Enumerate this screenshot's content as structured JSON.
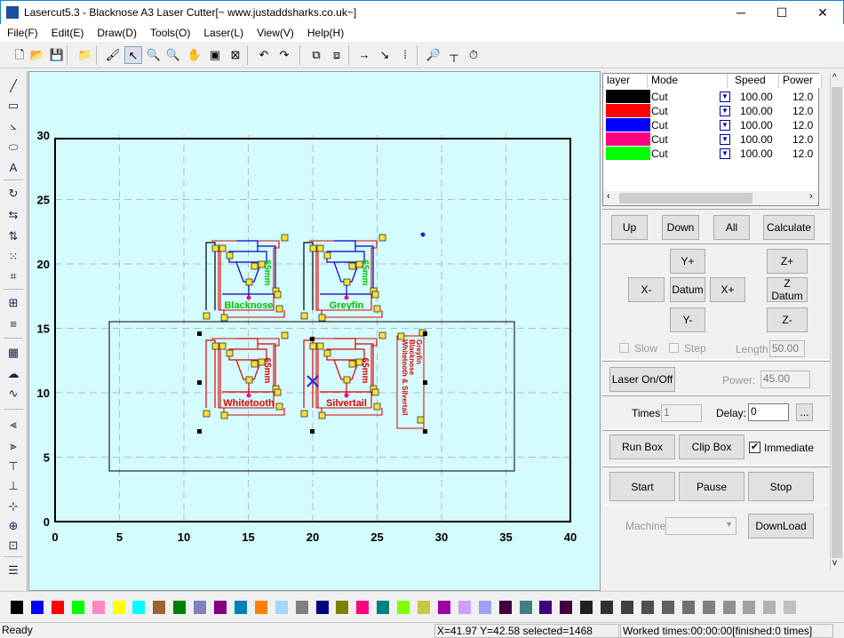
{
  "window": {
    "title": "Lasercut5.3 - Blacknose A3 Laser Cutter[~ www.justaddsharks.co.uk~]",
    "minimize": "─",
    "maximize": "☐",
    "close": "✕"
  },
  "menu": [
    "File(F)",
    "Edit(E)",
    "Draw(D)",
    "Tools(O)",
    "Laser(L)",
    "View(V)",
    "Help(H)"
  ],
  "toolbar": [
    {
      "icon": "new-file-icon",
      "glyph": "🗋"
    },
    {
      "icon": "open-folder-icon",
      "glyph": "📂"
    },
    {
      "icon": "save-icon",
      "glyph": "💾"
    },
    {
      "icon": "import-icon",
      "glyph": "📁"
    },
    {
      "icon": "brush-icon",
      "glyph": "🖌"
    },
    {
      "icon": "select-pointer-icon",
      "glyph": "↖"
    },
    {
      "icon": "zoom-in-icon",
      "glyph": "🔍"
    },
    {
      "icon": "zoom-out-icon",
      "glyph": "🔍"
    },
    {
      "icon": "pan-hand-icon",
      "glyph": "✋"
    },
    {
      "icon": "fit-page-icon",
      "glyph": "▣"
    },
    {
      "icon": "fit-selection-icon",
      "glyph": "⊠"
    },
    {
      "icon": "undo-icon",
      "glyph": "↶"
    },
    {
      "icon": "redo-icon",
      "glyph": "↷"
    },
    {
      "icon": "group-icon",
      "glyph": "⧉"
    },
    {
      "icon": "ungroup-icon",
      "glyph": "⧈"
    },
    {
      "icon": "cut-direction-icon",
      "glyph": "→"
    },
    {
      "icon": "start-point-icon",
      "glyph": "↘"
    },
    {
      "icon": "array-icon",
      "glyph": "⁞"
    },
    {
      "icon": "preview-icon",
      "glyph": "🔎"
    },
    {
      "icon": "ruler-icon",
      "glyph": "┬"
    },
    {
      "icon": "timer-icon",
      "glyph": "⏱"
    }
  ],
  "lefttools": [
    {
      "icon": "line-icon",
      "glyph": "╱"
    },
    {
      "icon": "rectangle-icon",
      "glyph": "▭"
    },
    {
      "icon": "polyline-icon",
      "glyph": "⦣"
    },
    {
      "icon": "ellipse-icon",
      "glyph": "⬭"
    },
    {
      "icon": "text-icon",
      "glyph": "A"
    },
    {
      "icon": "rotate-icon",
      "glyph": "↻"
    },
    {
      "icon": "mirror-horizontal-icon",
      "glyph": "⇆"
    },
    {
      "icon": "mirror-vertical-icon",
      "glyph": "⇅"
    },
    {
      "icon": "node-edit-icon",
      "glyph": "⁙"
    },
    {
      "icon": "crop-icon",
      "glyph": "⌗"
    },
    {
      "icon": "grid-array-icon",
      "glyph": "⊞"
    },
    {
      "icon": "align-lines-icon",
      "glyph": "≡"
    },
    {
      "icon": "hatch-icon",
      "glyph": "▦"
    },
    {
      "icon": "cloud-icon",
      "glyph": "☁"
    },
    {
      "icon": "curve-icon",
      "glyph": "∿"
    },
    {
      "icon": "align-left-icon",
      "glyph": "⫷"
    },
    {
      "icon": "align-right-icon",
      "glyph": "⫸"
    },
    {
      "icon": "align-top-icon",
      "glyph": "⊤"
    },
    {
      "icon": "align-bottom-icon",
      "glyph": "⊥"
    },
    {
      "icon": "center-horizontal-icon",
      "glyph": "⊹"
    },
    {
      "icon": "center-vertical-icon",
      "glyph": "⊕"
    },
    {
      "icon": "center-both-icon",
      "glyph": "⊡"
    },
    {
      "icon": "layers-icon",
      "glyph": "☰"
    }
  ],
  "canvas": {
    "x_ticks": [
      "0",
      "5",
      "10",
      "15",
      "20",
      "25",
      "30",
      "35",
      "40"
    ],
    "y_ticks": [
      "0",
      "5",
      "10",
      "15",
      "20",
      "25",
      "30"
    ],
    "tags": [
      {
        "name": "Blacknose",
        "size": "65mm",
        "color": "#00c000",
        "outline": "#0000c0",
        "loop": "#000000"
      },
      {
        "name": "Greyfin",
        "size": "65mm",
        "color": "#00c000",
        "outline": "#0000c0",
        "loop": "#000000"
      },
      {
        "name": "Whitetooth",
        "size": "65mm",
        "color": "#e00000",
        "outline": "#e00000",
        "loop": "#e00000"
      },
      {
        "name": "Silvertail",
        "size": "65mm",
        "color": "#e00000",
        "outline": "#e00000",
        "loop": "#e00000"
      }
    ],
    "side_label": [
      "Greyfin",
      "Blacknose",
      "Whitetooth & Silvertail"
    ]
  },
  "layers": {
    "headers": [
      "layer",
      "Mode",
      "Speed",
      "Power"
    ],
    "rows": [
      {
        "color": "#000000",
        "mode": "Cut",
        "speed": "100.00",
        "power": "12.0"
      },
      {
        "color": "#ff0000",
        "mode": "Cut",
        "speed": "100.00",
        "power": "12.0"
      },
      {
        "color": "#0000ff",
        "mode": "Cut",
        "speed": "100.00",
        "power": "12.0"
      },
      {
        "color": "#ff0080",
        "mode": "Cut",
        "speed": "100.00",
        "power": "12.0"
      },
      {
        "color": "#00ff00",
        "mode": "Cut",
        "speed": "100.00",
        "power": "12.0"
      }
    ]
  },
  "buttons": {
    "up": "Up",
    "down": "Down",
    "all": "All",
    "calculate": "Calculate",
    "yplus": "Y+",
    "xminus": "X-",
    "datum": "Datum",
    "xplus": "X+",
    "yminus": "Y-",
    "zplus": "Z+",
    "zdatum": "Z Datum",
    "zminus": "Z-",
    "laser": "Laser On/Off",
    "ellipsis": "...",
    "runbox": "Run Box",
    "clipbox": "Clip Box",
    "start": "Start",
    "pause": "Pause",
    "stop": "Stop",
    "download": "DownLoad"
  },
  "controls": {
    "slow": "Slow",
    "step": "Step",
    "length_label": "Length:",
    "length": "50.00",
    "power_label": "Power:",
    "power": "45.00",
    "times_label": "Times:",
    "times": "1",
    "delay_label": "Delay:",
    "delay": "0",
    "immediate": "Immediate",
    "immediate_checked": true,
    "machine_label": "Machine:",
    "machine": ""
  },
  "palette": [
    "#000000",
    "#0000ff",
    "#ff0000",
    "#00ff00",
    "#ff88c0",
    "#ffff00",
    "#00ffff",
    "#996633",
    "#008000",
    "#8080c0",
    "#800080",
    "#0080c0",
    "#ff8000",
    "#a0d8f8",
    "#808080",
    "#000080",
    "#808000",
    "#ff0080",
    "#008080",
    "#80ff00",
    "#c8c840",
    "#a000a0",
    "#d0a0f8",
    "#a0a0f8",
    "#400040",
    "#408080",
    "#400080",
    "#400040",
    "#202020",
    "#303030",
    "#404040",
    "#505050",
    "#606060",
    "#707070",
    "#808080",
    "#909090",
    "#a0a0a0",
    "#b0b0b0",
    "#c0c0c0"
  ],
  "status": {
    "ready": "Ready",
    "coords": "X=41.97 Y=42.58 selected=1468",
    "worked": "Worked times:00:00:00[finished:0 times]"
  }
}
